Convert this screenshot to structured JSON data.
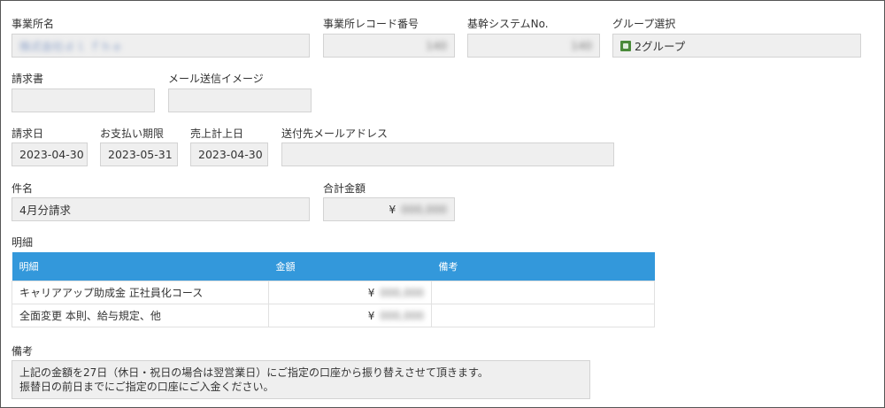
{
  "fields": {
    "office_name": {
      "label": "事業所名",
      "value": "株式会社ｄｌ ｆｈｅ"
    },
    "office_record_no": {
      "label": "事業所レコード番号",
      "value": "140"
    },
    "core_system_no": {
      "label": "基幹システムNo.",
      "value": "140"
    },
    "group_select": {
      "label": "グループ選択",
      "value": "2グループ"
    },
    "invoice": {
      "label": "請求書",
      "value": ""
    },
    "mail_image": {
      "label": "メール送信イメージ",
      "value": ""
    },
    "invoice_date": {
      "label": "請求日",
      "value": "2023-04-30"
    },
    "payment_due": {
      "label": "お支払い期限",
      "value": "2023-05-31"
    },
    "sales_date": {
      "label": "売上計上日",
      "value": "2023-04-30"
    },
    "send_email": {
      "label": "送付先メールアドレス",
      "value": ""
    },
    "subject": {
      "label": "件名",
      "value": "4月分請求"
    },
    "total": {
      "label": "合計金額",
      "currency": "¥",
      "value": "000,000"
    }
  },
  "details": {
    "section_label": "明細",
    "headers": [
      "明細",
      "金額",
      "備考"
    ],
    "rows": [
      {
        "item": "キャリアアップ助成金 正社員化コース",
        "currency": "¥",
        "amount": "000,000",
        "note": ""
      },
      {
        "item": "全面変更 本則、給与規定、他",
        "currency": "¥",
        "amount": "000,000",
        "note": ""
      }
    ]
  },
  "remarks": {
    "label": "備考",
    "lines": [
      "上記の金額を27日（休日・祝日の場合は翌営業日）にご指定の口座から振り替えさせて頂きます。",
      "振替日の前日までにご指定の口座にご入金ください。"
    ]
  }
}
